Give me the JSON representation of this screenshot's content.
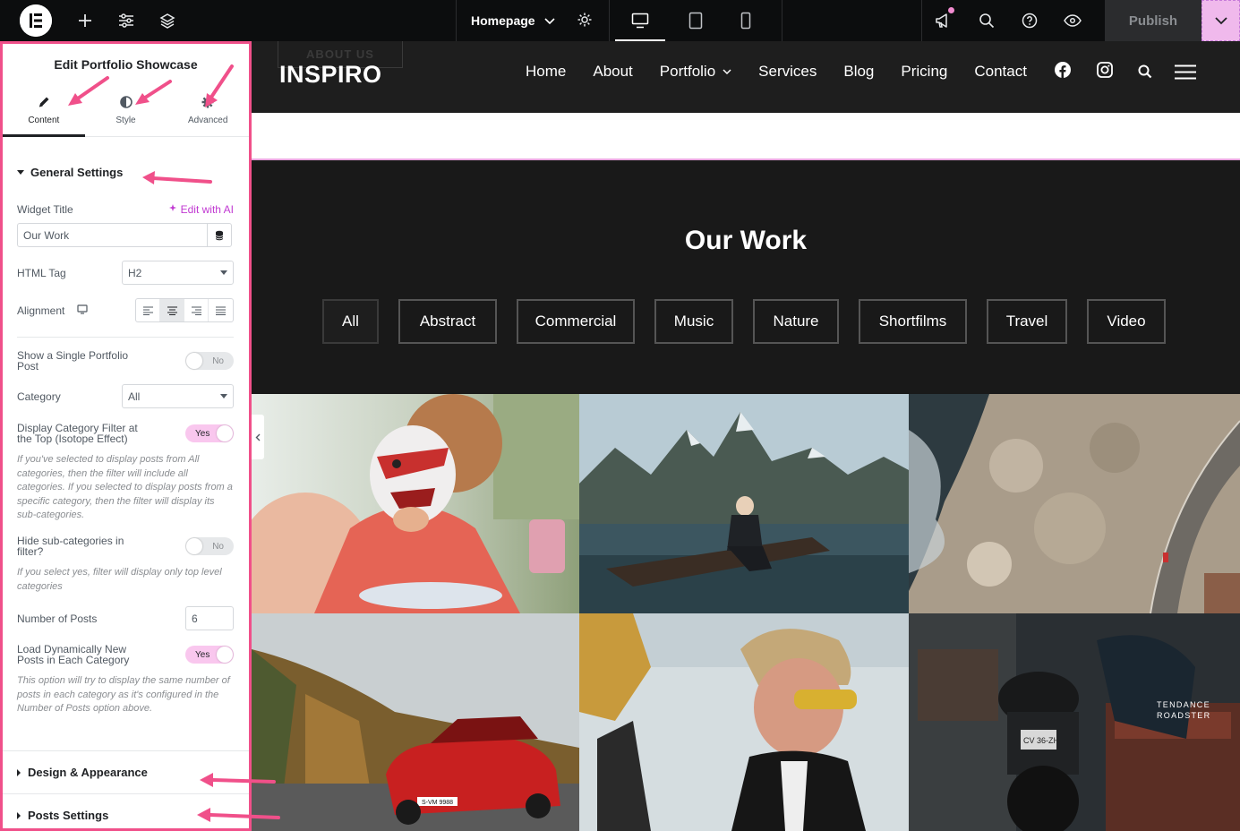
{
  "topbar": {
    "page_name": "Homepage",
    "publish_label": "Publish",
    "icons": [
      "elementor-logo-icon",
      "add-icon",
      "settings-sliders-icon",
      "layers-icon",
      "page-settings-icon",
      "desktop-icon",
      "tablet-icon",
      "mobile-icon",
      "notifications-icon",
      "search-icon",
      "help-icon",
      "preview-eye-icon",
      "chevron-down-icon"
    ]
  },
  "panel": {
    "title": "Edit Portfolio Showcase",
    "tabs": [
      {
        "label": "Content",
        "icon": "pencil-icon"
      },
      {
        "label": "Style",
        "icon": "contrast-icon"
      },
      {
        "label": "Advanced",
        "icon": "gear-icon"
      }
    ],
    "general": {
      "heading": "General Settings",
      "widget_title_label": "Widget Title",
      "edit_ai_label": "Edit with AI",
      "widget_title_value": "Our Work",
      "html_tag_label": "HTML Tag",
      "html_tag_value": "H2",
      "alignment_label": "Alignment",
      "single_post_label_1": "Show a Single Portfolio",
      "single_post_label_2": "Post",
      "single_post_value": "No",
      "category_label": "Category",
      "category_value": "All",
      "display_filter_label_1": "Display Category Filter at",
      "display_filter_label_2": "the Top (Isotope Effect)",
      "display_filter_value": "Yes",
      "display_filter_help": "If you've selected to display posts from All categories, then the filter will include all categories. If you selected to display posts from a specific category, then the filter will display its sub-categories.",
      "hide_sub_label_1": "Hide sub-categories in",
      "hide_sub_label_2": "filter?",
      "hide_sub_value": "No",
      "hide_sub_help": "If you select yes, filter will display only top level categories",
      "num_posts_label": "Number of Posts",
      "num_posts_value": "6",
      "load_dyn_label_1": "Load Dynamically New",
      "load_dyn_label_2": "Posts in Each Category",
      "load_dyn_value": "Yes",
      "load_dyn_help": "This option will try to display the same number of posts in each category as it's configured in the Number of Posts option above."
    },
    "sections": [
      {
        "label": "Design & Appearance"
      },
      {
        "label": "Posts Settings"
      }
    ]
  },
  "preview": {
    "about_us": "ABOUT US",
    "logo": "INSPIRO",
    "nav": [
      {
        "label": "Home"
      },
      {
        "label": "About"
      },
      {
        "label": "Portfolio"
      },
      {
        "label": "Services"
      },
      {
        "label": "Blog"
      },
      {
        "label": "Pricing"
      },
      {
        "label": "Contact"
      }
    ],
    "heading": "Our Work",
    "filters": [
      "All",
      "Abstract",
      "Commercial",
      "Music",
      "Nature",
      "Shortfilms",
      "Travel",
      "Video"
    ],
    "tiles": [
      {
        "name": "face-paint-girl"
      },
      {
        "name": "mountain-lake-man"
      },
      {
        "name": "aerial-coast-road"
      },
      {
        "name": "red-car-autumn"
      },
      {
        "name": "man-sunglasses-snow"
      },
      {
        "name": "motorcycle-garage",
        "caption_1": "TENDANCE",
        "caption_2": "ROADSTER"
      }
    ],
    "car_plate": "S-VM 9988",
    "bike_plate": "CV 36-ZH"
  },
  "colors": {
    "accent_pink": "#f0508a",
    "toggle_on": "#f9c7ee",
    "ai_purple": "#c13ad2"
  }
}
